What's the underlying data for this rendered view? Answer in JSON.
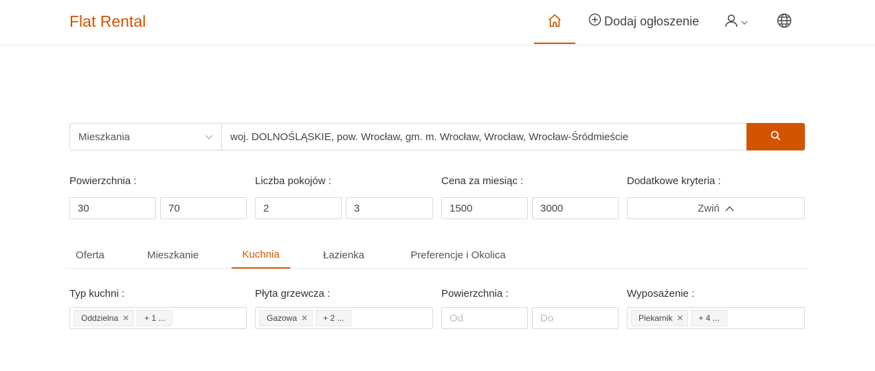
{
  "header": {
    "logo": "Flat Rental",
    "add_listing": "Dodaj ogłoszenie"
  },
  "search": {
    "type_value": "Mieszkania",
    "location_value": "woj. DOLNOŚLĄSKIE, pow. Wrocław, gm. m. Wrocław, Wrocław, Wrocław-Śródmieście"
  },
  "filters": {
    "area": {
      "label": "Powierzchnia",
      "min": "30",
      "max": "70"
    },
    "rooms": {
      "label": "Liczba pokojów",
      "min": "2",
      "max": "3"
    },
    "price": {
      "label": "Cena za miesiąc",
      "min": "1500",
      "max": "3000"
    },
    "extra": {
      "label": "Dodatkowe kryteria",
      "button": "Zwiń"
    }
  },
  "tabs": [
    "Oferta",
    "Mieszkanie",
    "Kuchnia",
    "Łazienka",
    "Preferencje i Okolica"
  ],
  "active_tab": "Kuchnia",
  "kitchen": {
    "type": {
      "label": "Typ kuchni",
      "tag": "Oddzielna",
      "more": "+ 1 ..."
    },
    "stove": {
      "label": "Płyta grzewcza",
      "tag": "Gazowa",
      "more": "+ 2 ..."
    },
    "area": {
      "label": "Powierzchnia",
      "from_placeholder": "Od",
      "to_placeholder": "Do"
    },
    "equipment": {
      "label": "Wyposażenie",
      "tag": "Piekarnik",
      "more": "+ 4 ..."
    }
  },
  "colors": {
    "accent": "#d35400",
    "border": "#d9d9d9"
  },
  "icons": [
    "home-icon",
    "plus-circle-icon",
    "user-icon",
    "chevron-down-icon",
    "globe-icon",
    "search-icon",
    "chevron-up-icon",
    "close-icon"
  ]
}
